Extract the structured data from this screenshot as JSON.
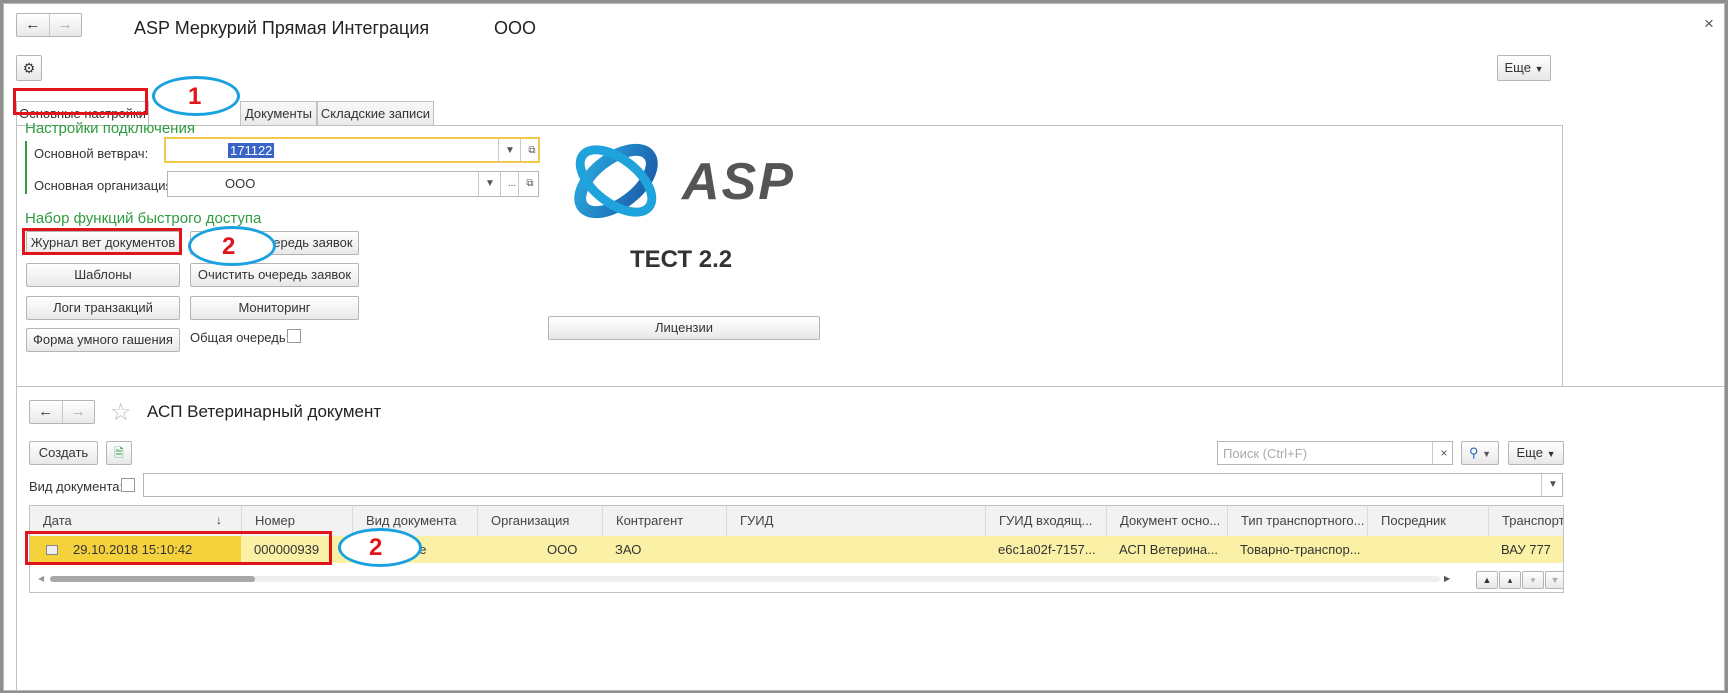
{
  "window": {
    "title": "ASP Меркурий Прямая Интеграция",
    "org": "ООО",
    "close": "×",
    "more_label": "Еще"
  },
  "tabs": [
    {
      "label": "Основные настройки",
      "active": true
    },
    {
      "label": "Документы",
      "active": false
    },
    {
      "label": "Складские записи",
      "active": false
    }
  ],
  "connection": {
    "section_title": "Настройки подключения",
    "vet_label": "Основной ветврач:",
    "vet_value": "171122",
    "org_label": "Основная организация:",
    "org_value": "ООО"
  },
  "quick": {
    "section_title": "Набор функций быстрого доступа",
    "buttons": [
      "Журнал вет документов",
      "Очередь заявок",
      "Шаблоны",
      "Очистить очередь заявок",
      "Логи транзакций",
      "Мониторинг",
      "Форма умного гашения"
    ],
    "general_queue_label": "Общая очередь:"
  },
  "logo": {
    "brand": "ASP",
    "test_label": "ТЕСТ 2.2",
    "license_button": "Лицензии"
  },
  "annotations": [
    "1",
    "2",
    "2"
  ],
  "subform": {
    "title": "АСП Ветеринарный документ",
    "create_label": "Создать",
    "search_placeholder": "Поиск (Ctrl+F)",
    "more_label": "Еще",
    "doc_type_label": "Вид документа:",
    "columns": [
      "Дата",
      "Номер",
      "Вид документа",
      "Организация",
      "Контрагент",
      "ГУИД",
      "ГУИД входящ...",
      "Документ осно...",
      "Тип транспортного...",
      "Посредник",
      "Транспорт"
    ],
    "row": {
      "date": "29.10.2018 15:10:42",
      "number": "000000939",
      "doc_type": "ие",
      "organization": "ООО",
      "counterparty": "ЗАО",
      "guid": "",
      "guid_in": "e6c1a02f-7157...",
      "base_doc": "АСП Ветерина...",
      "transport_type": "Товарно-транспор...",
      "intermediary": "",
      "transport": "ВАУ 777"
    }
  },
  "colors": {
    "accent_green": "#2e9c3f",
    "highlight_row": "#fbf1a6",
    "annotation_red": "#e0141c",
    "annotation_blue": "#1aa1e0"
  }
}
